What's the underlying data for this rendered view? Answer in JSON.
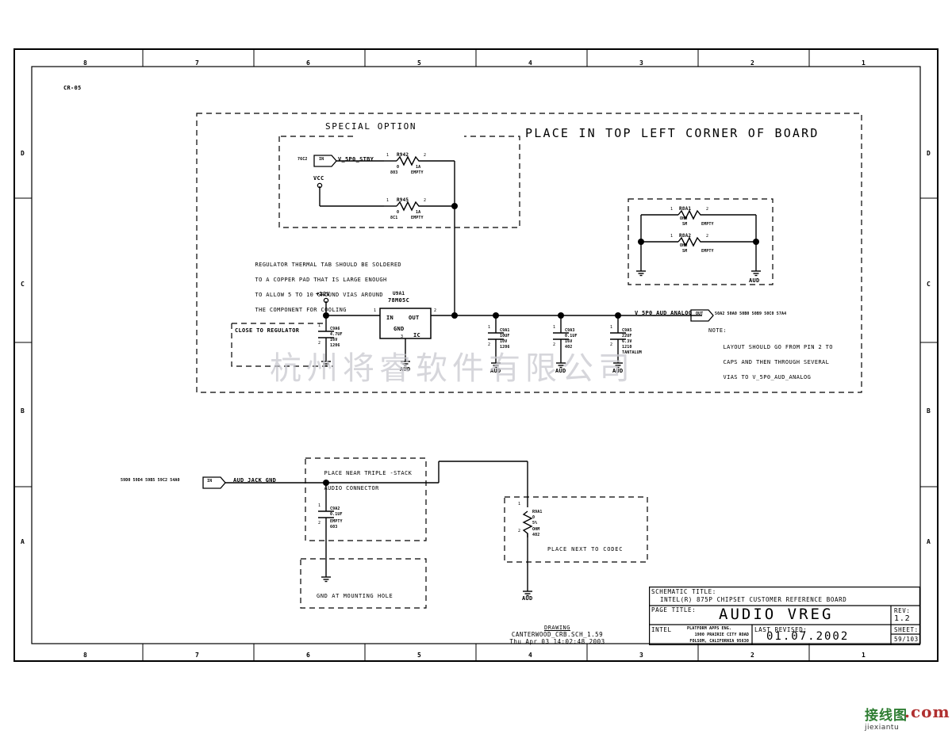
{
  "sheet": {
    "drawing_marker": "CR-05",
    "border_zones_top": [
      "8",
      "7",
      "6",
      "5",
      "4",
      "3",
      "2",
      "1"
    ],
    "border_zones_bottom": [
      "8",
      "7",
      "6",
      "5",
      "4",
      "3",
      "2",
      "1"
    ],
    "border_rows_left": [
      "D",
      "C",
      "B",
      "A"
    ],
    "border_rows_right": [
      "D",
      "C",
      "B",
      "A"
    ]
  },
  "title_block": {
    "schematic_title_label": "SCHEMATIC TITLE:",
    "schematic_title": "INTEL(R) 875P CHIPSET CUSTOMER REFERENCE BOARD",
    "page_title_label": "PAGE TITLE:",
    "page_title": "AUDIO VREG",
    "rev_label": "REV:",
    "rev": "1.2",
    "company": "INTEL",
    "dept": "PLATFORM APPS ENG.",
    "address_line1": "1900 PRAIRIE CITY ROAD",
    "address_line2": "FOLSOM, CALIFORNIA 95630",
    "last_revised_label": "LAST REVISED:",
    "last_revised": "01.07.2002",
    "sheet_label": "SHEET:",
    "sheet": "59/103"
  },
  "drawing_stamp": {
    "heading": "DRAWING",
    "file": "CANTERWOOD_CRB.SCH_1.59",
    "timestamp": "Thu Apr 03 14:02:48 2003"
  },
  "headings": {
    "special_option": "SPECIAL OPTION",
    "place_top_left": "PLACE IN TOP LEFT CORNER OF BOARD",
    "close_to_regulator": "CLOSE TO REGULATOR",
    "place_near_triple_stack_1": "PLACE NEAR TRIPLE -STACK",
    "place_near_triple_stack_2": "AUDIO CONNECTOR",
    "place_next_to_codec": "PLACE NEXT TO CODEC",
    "gnd_at_mounting_hole": "GND AT MOUNTING HOLE"
  },
  "notes": {
    "thermal": [
      "REGULATOR THERMAL TAB SHOULD BE SOLDERED",
      "TO A COPPER PAD THAT IS LARGE ENOUGH",
      "TO ALLOW 5 TO 10 GROUND VIAS AROUND",
      "THE COMPONENT FOR COOLING"
    ],
    "layout_label": "NOTE:",
    "layout": [
      "LAYOUT SHOULD GO FROM PIN 2 TO",
      "CAPS AND THEN THROUGH SEVERAL",
      "VIAS TO V_5P0_AUD_ANALOG"
    ]
  },
  "nets": {
    "v_5p0_stby": "V_5P0_STBY",
    "vcc": "VCC",
    "v12": "+12V",
    "v_5p0_aud_analog": "V_5P0_AUD_ANALOG",
    "aud_jack_gnd": "AUD_JACK_GND",
    "gnd_aud": "AUD",
    "port_in": "IN",
    "port_out": "OUT"
  },
  "xrefs": {
    "stby_left": "76C2",
    "analog_right": "50A2 50A0 50B0 50B9 50C0 57A4",
    "jack_left": "59D0 59D4 59B5 59C2 54A0"
  },
  "components": {
    "r942": {
      "ref": "R942",
      "pin1": "1",
      "pin2": "2",
      "val1": "0",
      "val2": "1A",
      "note": "EMPTY",
      "pkg": "803"
    },
    "r945": {
      "ref": "R945",
      "pin1": "1",
      "pin2": "2",
      "val1": "0",
      "val2": "1A",
      "note": "EMPTY",
      "pkg": "8C1"
    },
    "r8a1": {
      "ref": "R8A1",
      "pin1": "1",
      "pin2": "2",
      "unit": "OHM",
      "size": "SM",
      "note": "EMPTY"
    },
    "r8a2": {
      "ref": "R8A2",
      "pin1": "1",
      "pin2": "2",
      "unit": "OHM",
      "size": "SM",
      "note": "EMPTY"
    },
    "u9a1": {
      "ref": "U9A1",
      "part": "78M05C",
      "pin_in": "IN",
      "pin_out": "OUT",
      "pin_gnd": "GND",
      "pin_ic": "IC",
      "num_in": "1",
      "num_out": "2",
      "num_gnd": "3"
    },
    "c9a6": {
      "ref": "C9A6",
      "pin1": "1",
      "pin2": "2",
      "val": "4.7UF",
      "volt": "16V",
      "pkg": "1206"
    },
    "c9a1": {
      "ref": "C9A1",
      "pin1": "1",
      "pin2": "2",
      "val": "10UF",
      "volt": "10V",
      "pkg": "1206"
    },
    "c9a3": {
      "ref": "C9A3",
      "pin1": "1",
      "pin2": "2",
      "val": "0.1UF",
      "volt": "16V",
      "pkg": "402"
    },
    "c9a5": {
      "ref": "C9A5",
      "pin1": "1",
      "pin2": "2",
      "val": "22UF",
      "volt": "6.3V",
      "pkg": "1210",
      "extra": "TANTALUM"
    },
    "c9a2": {
      "ref": "C9A2",
      "pin1": "1",
      "pin2": "2",
      "val": "0.1UF",
      "note": "EMPTY",
      "pkg": "603"
    },
    "r9a1": {
      "ref": "R9A1",
      "pin1": "1",
      "pin2": "2",
      "val": "0",
      "tol": "5%",
      "unit": "OHM",
      "pkg": "402"
    }
  },
  "watermark": {
    "cn": "杭州将睿软件有限公司",
    "site_cn": "接线图",
    "site": "jiexiantu",
    "site_tld": ".com"
  }
}
